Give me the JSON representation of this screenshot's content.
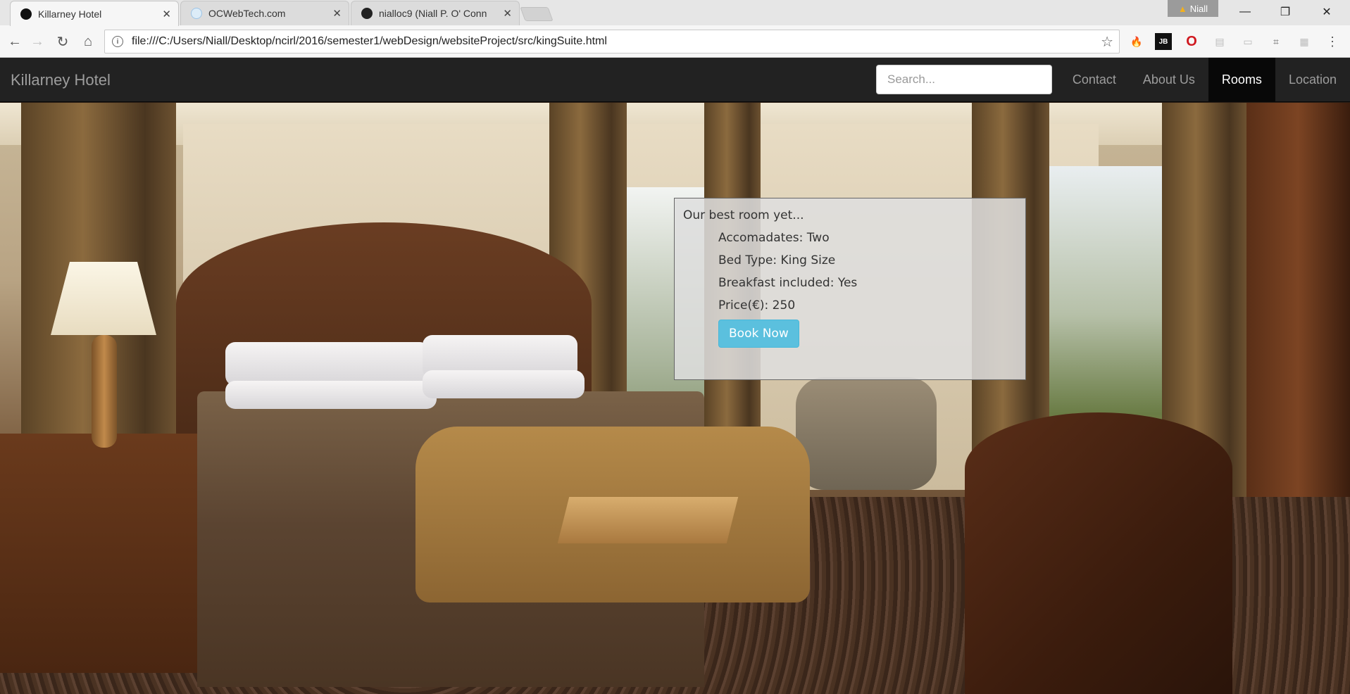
{
  "browser": {
    "tabs": [
      {
        "title": "Killarney Hotel",
        "active": true,
        "favicon_color": "#111111"
      },
      {
        "title": "OCWebTech.com",
        "active": false,
        "favicon_color": "#dcecf8"
      },
      {
        "title": "nialloc9 (Niall P. O' Conn",
        "active": false,
        "favicon_color": "#222222"
      }
    ],
    "profile_name": "Niall",
    "url": "file:///C:/Users/Niall/Desktop/ncirl/2016/semester1/webDesign/websiteProject/src/kingSuite.html"
  },
  "site": {
    "brand": "Killarney Hotel",
    "search_placeholder": "Search...",
    "nav": [
      {
        "label": "Contact",
        "active": false
      },
      {
        "label": "About Us",
        "active": false
      },
      {
        "label": "Rooms",
        "active": true
      },
      {
        "label": "Location",
        "active": false
      }
    ]
  },
  "room": {
    "intro": "Our best room yet...",
    "details": [
      "Accomadates: Two",
      "Bed Type: King Size",
      "Breakfast included: Yes",
      "Price(€): 250"
    ],
    "book_label": "Book Now"
  },
  "colors": {
    "navbar_bg": "#222222",
    "nav_active_bg": "#080808",
    "book_button": "#5bc0de"
  }
}
